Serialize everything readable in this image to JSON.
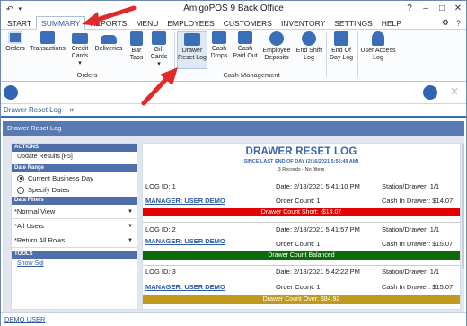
{
  "window": {
    "title": "AmigoPOS 9 Back Office",
    "controls": [
      "?",
      "–",
      "□",
      "✕"
    ]
  },
  "menu": {
    "tabs": [
      "START",
      "SUMMARY",
      "REPORTS",
      "MENU",
      "EMPLOYEES",
      "CUSTOMERS",
      "INVENTORY",
      "SETTINGS",
      "HELP"
    ]
  },
  "ribbon": {
    "orders": {
      "label": "Orders",
      "buttons": [
        "Orders",
        "Transactions",
        "Credit Cards ▾",
        "Deliveries",
        "Bar Tabs",
        "Gift Cards ▾"
      ]
    },
    "cash": {
      "label": "Cash Management",
      "buttons": [
        "Drawer Reset Log",
        "Cash Drops",
        "Cash Paid Out",
        "Employee Deposits",
        "End Shift Log",
        "End Of Day Log",
        "User Access Log"
      ]
    }
  },
  "doc_tab": {
    "label": "Drawer Reset Log",
    "close": "✕"
  },
  "panel_header": "Drawer Reset Log",
  "left": {
    "actions": {
      "title": "ACTIONS",
      "item": "Update Results [F5]"
    },
    "date_range": {
      "title": "Date Range",
      "options": [
        "Current Business Day",
        "Specify Dates"
      ],
      "selected": 0
    },
    "filters": {
      "title": "Data Filters",
      "dropdowns": [
        "*Normal View",
        "*All Users",
        "*Return All Rows"
      ]
    },
    "tools": {
      "title": "TOOLS",
      "link": "Show Sql"
    }
  },
  "report": {
    "title": "DRAWER RESET LOG",
    "subtitle": "SINCE LAST END OF DAY (2/16/2021 5:56:49 AM)",
    "count": "3 Records - No filters",
    "entries": [
      {
        "id": "LOG ID: 1",
        "date": "Date: 2/18/2021 5:41:10 PM",
        "station": "Station/Drawer: 1/1",
        "user": "MANAGER: USER DEMO",
        "order": "Order Count: 1",
        "cash": "Cash In Drawer: $14.07",
        "status": "Drawer Count Short: -$14.07",
        "color": "#e30000"
      },
      {
        "id": "LOG ID: 2",
        "date": "Date: 2/18/2021 5:41:57 PM",
        "station": "Station/Drawer: 1/1",
        "user": "MANAGER: USER DEMO",
        "order": "Order Count: 1",
        "cash": "Cash In Drawer: $15.07",
        "status": "Drawer Count Balanced",
        "color": "#0d6a0d"
      },
      {
        "id": "LOG ID: 3",
        "date": "Date: 2/18/2021 5:42:22 PM",
        "station": "Station/Drawer: 1/1",
        "user": "MANAGER: USER DEMO",
        "order": "Order Count: 1",
        "cash": "Cash In Drawer: $15.07",
        "status": "Drawer Count Over: $84.92",
        "color": "#c09a1e"
      }
    ]
  },
  "status": {
    "user": "DEMO USER"
  },
  "colors": {
    "accent": "#3b66ad",
    "arrow": "#e02a2a"
  }
}
